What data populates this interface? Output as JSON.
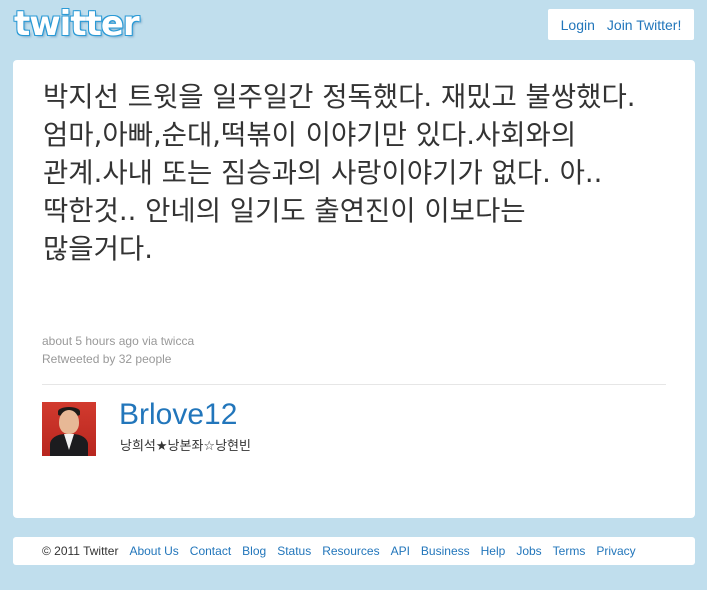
{
  "header": {
    "logo_text": "twitter",
    "login_label": "Login",
    "join_label": "Join Twitter!"
  },
  "tweet": {
    "text": "박지선 트윗을 일주일간 정독했다. 재밌고 불쌍했다. 엄마,아빠,순대,떡볶이 이야기만 있다.사회와의 관계.사내 또는 짐승과의 사랑이야기가 없다. 아..딱한것.. 안네의 일기도 출연진이 이보다는 많을거다.",
    "time": "about 5 hours ago",
    "via_prefix": "via",
    "via_app": "twicca",
    "retweet_prefix": "Retweeted by",
    "retweet_count_text": "32 people"
  },
  "author": {
    "screen_name": "Brlove12",
    "full_name": "낭희석★낭본좌☆낭현빈"
  },
  "footer": {
    "copyright": "© 2011 Twitter",
    "links": [
      "About Us",
      "Contact",
      "Blog",
      "Status",
      "Resources",
      "API",
      "Business",
      "Help",
      "Jobs",
      "Terms",
      "Privacy"
    ]
  },
  "colors": {
    "background": "#c0deed",
    "link": "#2276bb",
    "text": "#333333",
    "meta": "#999999"
  }
}
